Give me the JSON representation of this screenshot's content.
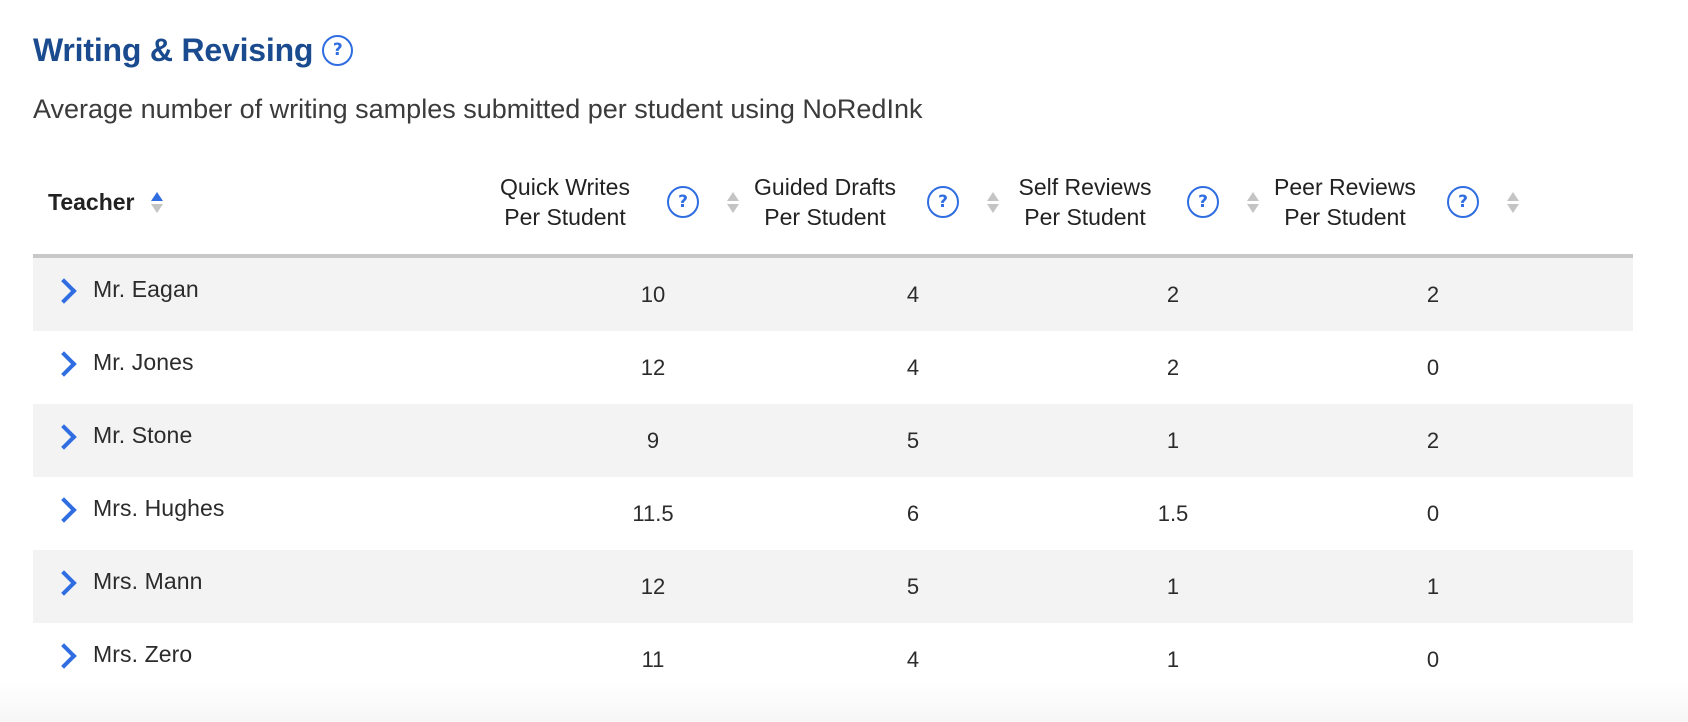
{
  "header": {
    "title": "Writing & Revising",
    "subtitle": "Average number of writing samples submitted per student using NoRedInk",
    "help_glyph": "?"
  },
  "table": {
    "teacher_header": "Teacher",
    "sort_state": "Teacher ascending",
    "columns": [
      {
        "line1": "Quick Writes",
        "line2": "Per Student"
      },
      {
        "line1": "Guided Drafts",
        "line2": "Per Student"
      },
      {
        "line1": "Self Reviews",
        "line2": "Per Student"
      },
      {
        "line1": "Peer Reviews",
        "line2": "Per Student"
      }
    ],
    "rows": [
      {
        "teacher": "Mr. Eagan",
        "values": [
          "10",
          "4",
          "2",
          "2"
        ]
      },
      {
        "teacher": "Mr. Jones",
        "values": [
          "12",
          "4",
          "2",
          "0"
        ]
      },
      {
        "teacher": "Mr. Stone",
        "values": [
          "9",
          "5",
          "1",
          "2"
        ]
      },
      {
        "teacher": "Mrs. Hughes",
        "values": [
          "11.5",
          "6",
          "1.5",
          "0"
        ]
      },
      {
        "teacher": "Mrs. Mann",
        "values": [
          "12",
          "5",
          "1",
          "1"
        ]
      },
      {
        "teacher": "Mrs. Zero",
        "values": [
          "11",
          "4",
          "1",
          "0"
        ]
      }
    ]
  },
  "icons": {
    "help": "question-circle-icon",
    "sort": "sort-arrows-icon",
    "expand": "chevron-right-icon"
  },
  "colors": {
    "title": "#1b4b8f",
    "accent": "#2f6de1",
    "row_stripe": "#f3f3f3",
    "header_rule": "#c8c8c8"
  }
}
